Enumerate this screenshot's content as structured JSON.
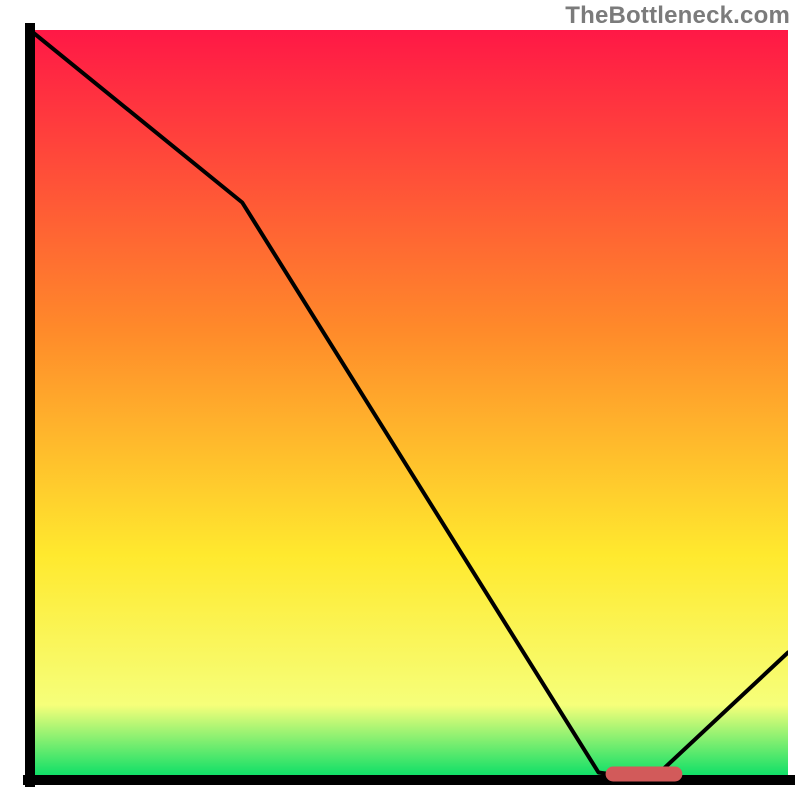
{
  "attribution": "TheBottleneck.com",
  "colors": {
    "gradient_top": "#ff1846",
    "gradient_mid1": "#ff8a2a",
    "gradient_mid2": "#ffe92e",
    "gradient_mid3": "#f6ff7a",
    "gradient_bottom": "#00dd66",
    "axis": "#000000",
    "curve": "#000000",
    "marker_fill": "#d25a5a",
    "marker_stroke": "#d25a5a"
  },
  "chart_data": {
    "type": "line",
    "title": "",
    "xlabel": "",
    "ylabel": "",
    "xlim": [
      0,
      100
    ],
    "ylim": [
      0,
      100
    ],
    "series": [
      {
        "name": "bottleneck-curve",
        "x": [
          0,
          28,
          75,
          82,
          100
        ],
        "values": [
          100,
          77,
          1,
          0,
          17
        ]
      }
    ],
    "annotations": [
      {
        "name": "optimal-marker",
        "type": "bar-segment",
        "x0": 76,
        "x1": 86,
        "y": 0.8
      }
    ]
  }
}
